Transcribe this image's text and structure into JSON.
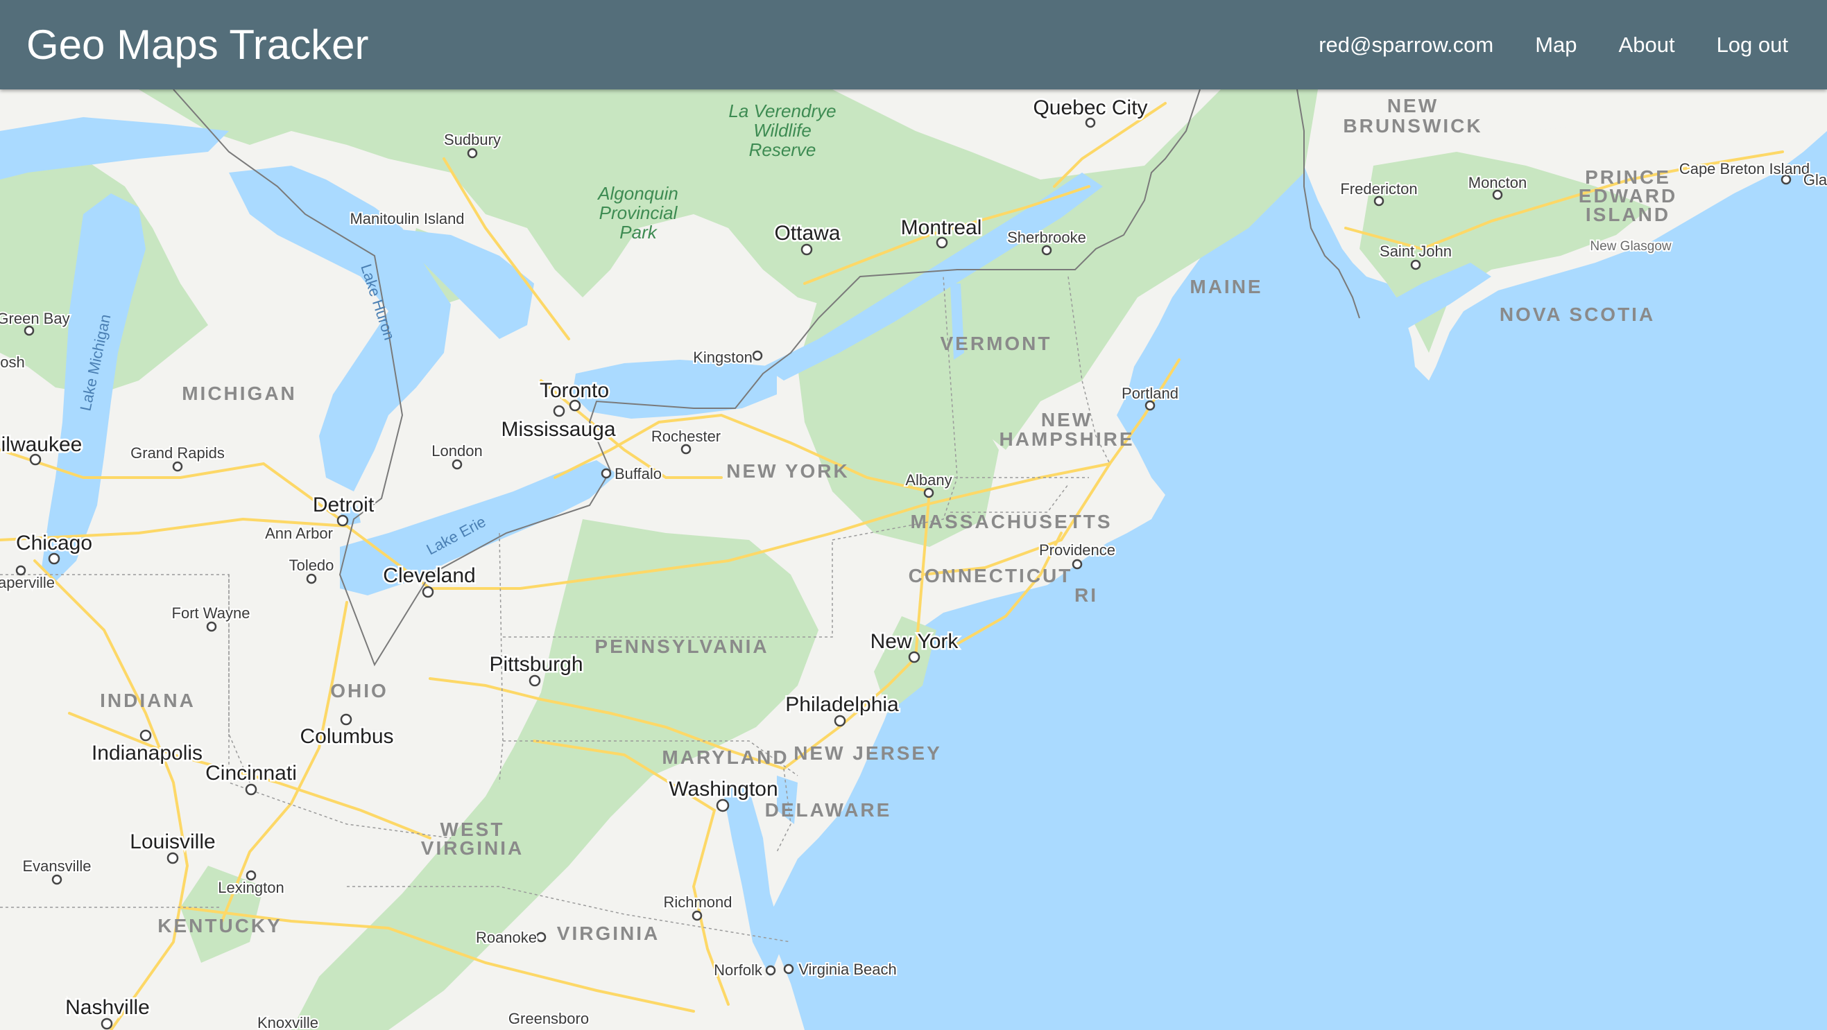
{
  "navbar": {
    "brand": "Geo Maps Tracker",
    "user_email": "red@sparrow.com",
    "map_link": "Map",
    "about_link": "About",
    "logout_link": "Log out"
  },
  "colors": {
    "navbar": "#546e7a",
    "water": "#aadaff",
    "land": "#f3f3f0",
    "forest": "#c8e6c1",
    "highway": "#fdd867"
  },
  "map": {
    "cities": {
      "quebec_city": "Quebec City",
      "sudbury": "Sudbury",
      "ottawa": "Ottawa",
      "montreal": "Montreal",
      "sherbrooke": "Sherbrooke",
      "fredericton": "Fredericton",
      "moncton": "Moncton",
      "cape_breton_island": "Cape Breton Island",
      "glace_bay": "Gla",
      "saint_john": "Saint John",
      "new_glasgow": "New Glasgow",
      "manitoulin_island": "Manitoulin Island",
      "green_bay": "Green Bay",
      "oshkosh": "osh",
      "kingston": "Kingston",
      "toronto": "Toronto",
      "mississauga": "Mississauga",
      "portland": "Portland",
      "milwaukee": "ilwaukee",
      "grand_rapids": "Grand Rapids",
      "london": "London",
      "rochester": "Rochester",
      "buffalo": "Buffalo",
      "albany": "Albany",
      "detroit": "Detroit",
      "ann_arbor": "Ann Arbor",
      "chicago": "Chicago",
      "providence": "Providence",
      "toledo": "Toledo",
      "naperville": "aperville",
      "cleveland": "Cleveland",
      "fort_wayne": "Fort Wayne",
      "new_york": "New York",
      "pittsburgh": "Pittsburgh",
      "philadelphia": "Philadelphia",
      "columbus": "Columbus",
      "indianapolis": "Indianapolis",
      "cincinnati": "Cincinnati",
      "washington": "Washington",
      "louisville": "Louisville",
      "evansville": "Evansville",
      "lexington": "Lexington",
      "richmond": "Richmond",
      "roanoke": "Roanoke",
      "norfolk": "Norfolk",
      "virginia_beach": "Virginia Beach",
      "nashville": "Nashville",
      "knoxville": "Knoxville",
      "greensboro": "Greensboro"
    },
    "regions": {
      "new_brunswick_1": "NEW",
      "new_brunswick_2": "BRUNSWICK",
      "pei_1": "PRINCE",
      "pei_2": "EDWARD",
      "pei_3": "ISLAND",
      "maine": "MAINE",
      "nova_scotia": "NOVA SCOTIA",
      "vermont": "VERMONT",
      "michigan": "MICHIGAN",
      "new_hampshire_1": "NEW",
      "new_hampshire_2": "HAMPSHIRE",
      "new_york": "NEW YORK",
      "massachusetts": "MASSACHUSETTS",
      "connecticut": "CONNECTICUT",
      "rhode_island": "RI",
      "pennsylvania": "PENNSYLVANIA",
      "ohio": "OHIO",
      "indiana": "INDIANA",
      "maryland": "MARYLAND",
      "new_jersey": "NEW JERSEY",
      "delaware": "DELAWARE",
      "west_virginia_1": "WEST",
      "west_virginia_2": "VIRGINIA",
      "virginia": "VIRGINIA",
      "kentucky": "KENTUCKY"
    },
    "parks": {
      "la_verendrye_1": "La Verendrye",
      "la_verendrye_2": "Wildlife",
      "la_verendrye_3": "Reserve",
      "algonquin_1": "Algonquin",
      "algonquin_2": "Provincial",
      "algonquin_3": "Park"
    },
    "water": {
      "lake_huron": "Lake Huron",
      "lake_michigan": "Lake Michigan",
      "lake_erie": "Lake Erie"
    }
  }
}
